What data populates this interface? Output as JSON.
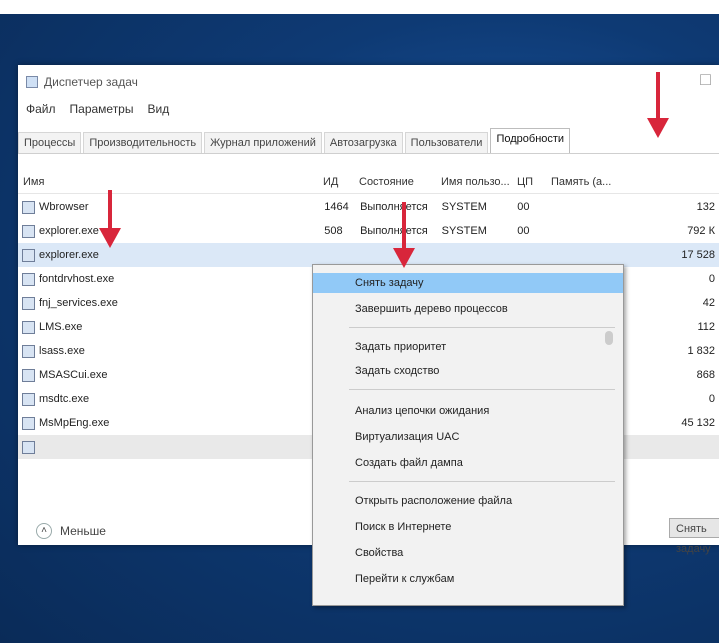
{
  "header_text": "",
  "window": {
    "title": "Диспетчер задач",
    "menu": [
      "Файл",
      "Параметры",
      "Вид"
    ],
    "tabs": [
      "Процессы",
      "Производительность",
      "Журнал приложений",
      "Автозагрузка",
      "Пользователи",
      "Подробности"
    ],
    "columns": [
      "Имя",
      "ИД",
      "Состояние",
      "Имя пользо...",
      "ЦП",
      "Память (а..."
    ],
    "rows": [
      {
        "name": "Wbrowser",
        "pid": "1464",
        "status": "Выполняется",
        "user": "SYSTEM",
        "cpu": "00",
        "mem": "132"
      },
      {
        "name": "explorer.exe",
        "pid": "508",
        "status": "Выполняется",
        "user": "SYSTEM",
        "cpu": "00",
        "mem": "792 К"
      },
      {
        "name": "explorer.exe",
        "pid": "",
        "status": "",
        "user": "",
        "cpu": "",
        "mem": "17 528"
      },
      {
        "name": "fontdrvhost.exe",
        "pid": "",
        "status": "",
        "user": "",
        "cpu": "",
        "mem": "0"
      },
      {
        "name": "fnj_services.exe",
        "pid": "",
        "status": "",
        "user": "",
        "cpu": "",
        "mem": "42"
      },
      {
        "name": "LMS.exe",
        "pid": "",
        "status": "",
        "user": "",
        "cpu": "",
        "mem": "112"
      },
      {
        "name": "lsass.exe",
        "pid": "",
        "status": "",
        "user": "",
        "cpu": "",
        "mem": "1 832"
      },
      {
        "name": "MSASCui.exe",
        "pid": "",
        "status": "",
        "user": "",
        "cpu": "",
        "mem": "868"
      },
      {
        "name": "msdtc.exe",
        "pid": "",
        "status": "",
        "user": "",
        "cpu": "",
        "mem": "0"
      },
      {
        "name": "MsMpEng.exe",
        "pid": "",
        "status": "",
        "user": "",
        "cpu": "",
        "mem": "45 132"
      },
      {
        "name": "",
        "pid": "",
        "status": "",
        "user": "",
        "cpu": "",
        "mem": ""
      }
    ],
    "footer_less": "Меньше",
    "end_task": "Снять задачу"
  },
  "context_menu": {
    "items": [
      "Снять задачу",
      "Завершить дерево процессов",
      "Задать приоритет",
      "Задать сходство",
      "Анализ цепочки ожидания",
      "Виртуализация UAC",
      "Создать файл дампа",
      "Открыть расположение файла",
      "Поиск в Интернете",
      "Свойства",
      "Перейти к службам"
    ],
    "active_index": 0
  },
  "colors": {
    "highlight": "#91c9f7",
    "selected_row": "#dbe8f7",
    "arrow": "#d8263b",
    "desktop": "#0e3a74"
  }
}
